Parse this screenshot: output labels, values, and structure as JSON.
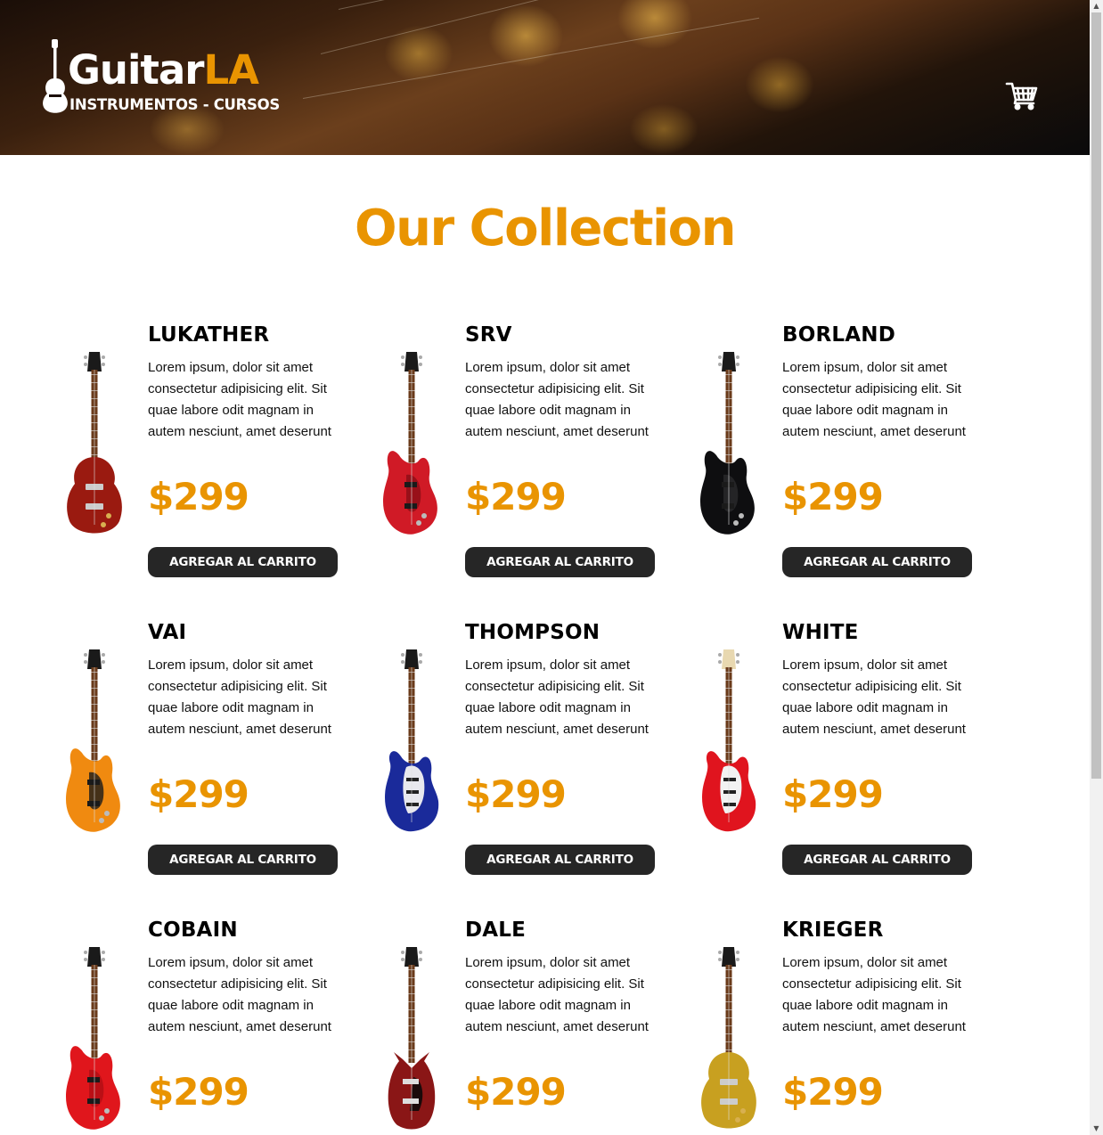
{
  "header": {
    "logo": {
      "brand_main": "Guitar",
      "brand_accent": "LA",
      "tagline": "INSTRUMENTOS - CURSOS"
    },
    "cart_icon": "shopping-cart-icon"
  },
  "collection": {
    "title": "Our Collection",
    "button_label": "Agregar al Carrito",
    "products": [
      {
        "name": "LUKATHER",
        "description": "Lorem ipsum, dolor sit amet consectetur adipisicing elit. Sit quae labore odit magnam in autem nesciunt, amet deserunt",
        "price": "$299",
        "body_color": "#9a1a10",
        "pickguard": "#2a0a06",
        "shape": "lespaul"
      },
      {
        "name": "SRV",
        "description": "Lorem ipsum, dolor sit amet consectetur adipisicing elit. Sit quae labore odit magnam in autem nesciunt, amet deserunt",
        "price": "$299",
        "body_color": "#d01a26",
        "pickguard": "#8a0e16",
        "shape": "superstrat"
      },
      {
        "name": "BORLAND",
        "description": "Lorem ipsum, dolor sit amet consectetur adipisicing elit. Sit quae labore odit magnam in autem nesciunt, amet deserunt",
        "price": "$299",
        "body_color": "#0e0e10",
        "pickguard": "#2a2a2c",
        "shape": "superstrat"
      },
      {
        "name": "VAI",
        "description": "Lorem ipsum, dolor sit amet consectetur adipisicing elit. Sit quae labore odit magnam in autem nesciunt, amet deserunt",
        "price": "$299",
        "body_color": "#f08a10",
        "pickguard": "#1a1a1a",
        "shape": "superstrat"
      },
      {
        "name": "THOMPSON",
        "description": "Lorem ipsum, dolor sit amet consectetur adipisicing elit. Sit quae labore odit magnam in autem nesciunt, amet deserunt",
        "price": "$299",
        "body_color": "#1a2a9a",
        "pickguard": "#e8e8ee",
        "shape": "strat"
      },
      {
        "name": "WHITE",
        "description": "Lorem ipsum, dolor sit amet consectetur adipisicing elit. Sit quae labore odit magnam in autem nesciunt, amet deserunt",
        "price": "$299",
        "body_color": "#e0141e",
        "pickguard": "#f2f2f2",
        "shape": "strat"
      },
      {
        "name": "COBAIN",
        "description": "Lorem ipsum, dolor sit amet consectetur adipisicing elit. Sit quae labore odit magnam in autem nesciunt, amet deserunt",
        "price": "$299",
        "body_color": "#e0161c",
        "pickguard": "#b00e14",
        "shape": "superstrat"
      },
      {
        "name": "DALE",
        "description": "Lorem ipsum, dolor sit amet consectetur adipisicing elit. Sit quae labore odit magnam in autem nesciunt, amet deserunt",
        "price": "$299",
        "body_color": "#8a1616",
        "pickguard": "#1a0a0a",
        "shape": "sg"
      },
      {
        "name": "KRIEGER",
        "description": "Lorem ipsum, dolor sit amet consectetur adipisicing elit. Sit quae labore odit magnam in autem nesciunt, amet deserunt",
        "price": "$299",
        "body_color": "#c8a020",
        "pickguard": "#8a6a10",
        "shape": "lespaul"
      }
    ]
  },
  "colors": {
    "accent": "#e99401",
    "button_bg": "#262626"
  }
}
